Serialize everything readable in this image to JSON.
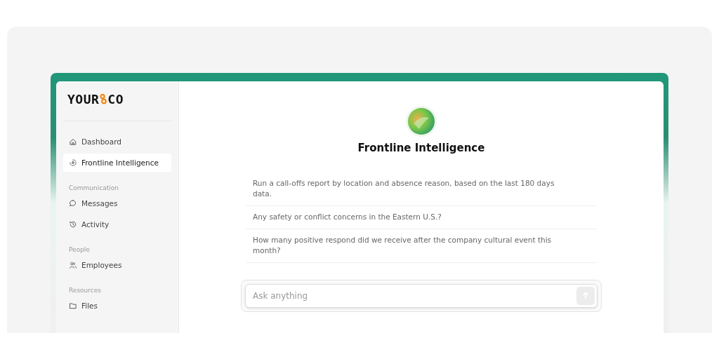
{
  "logo": {
    "first": "YOUR",
    "last": "CO"
  },
  "sidebar": {
    "sections": [
      {
        "items": [
          {
            "label": "Dashboard",
            "kind": "home",
            "selected": false
          },
          {
            "label": "Frontline Intelligence",
            "kind": "spark",
            "selected": true
          }
        ]
      },
      {
        "title": "Communication",
        "items": [
          {
            "label": "Messages",
            "kind": "chat",
            "selected": false
          },
          {
            "label": "Activity",
            "kind": "history",
            "selected": false
          }
        ]
      },
      {
        "title": "People",
        "items": [
          {
            "label": "Employees",
            "kind": "people",
            "selected": false
          }
        ]
      },
      {
        "title": "Resources",
        "items": [
          {
            "label": "Files",
            "kind": "folder",
            "selected": false
          }
        ]
      }
    ]
  },
  "assistant": {
    "title": "Frontline Intelligence"
  },
  "suggestions": [
    "Run a call-offs report by location and absence reason, based on the last 180 days data.",
    "Any safety or conflict concerns in the Eastern U.S.?",
    "How many positive respond did we receive after the company cultural event this month?"
  ],
  "composer": {
    "placeholder": "Ask anything"
  }
}
